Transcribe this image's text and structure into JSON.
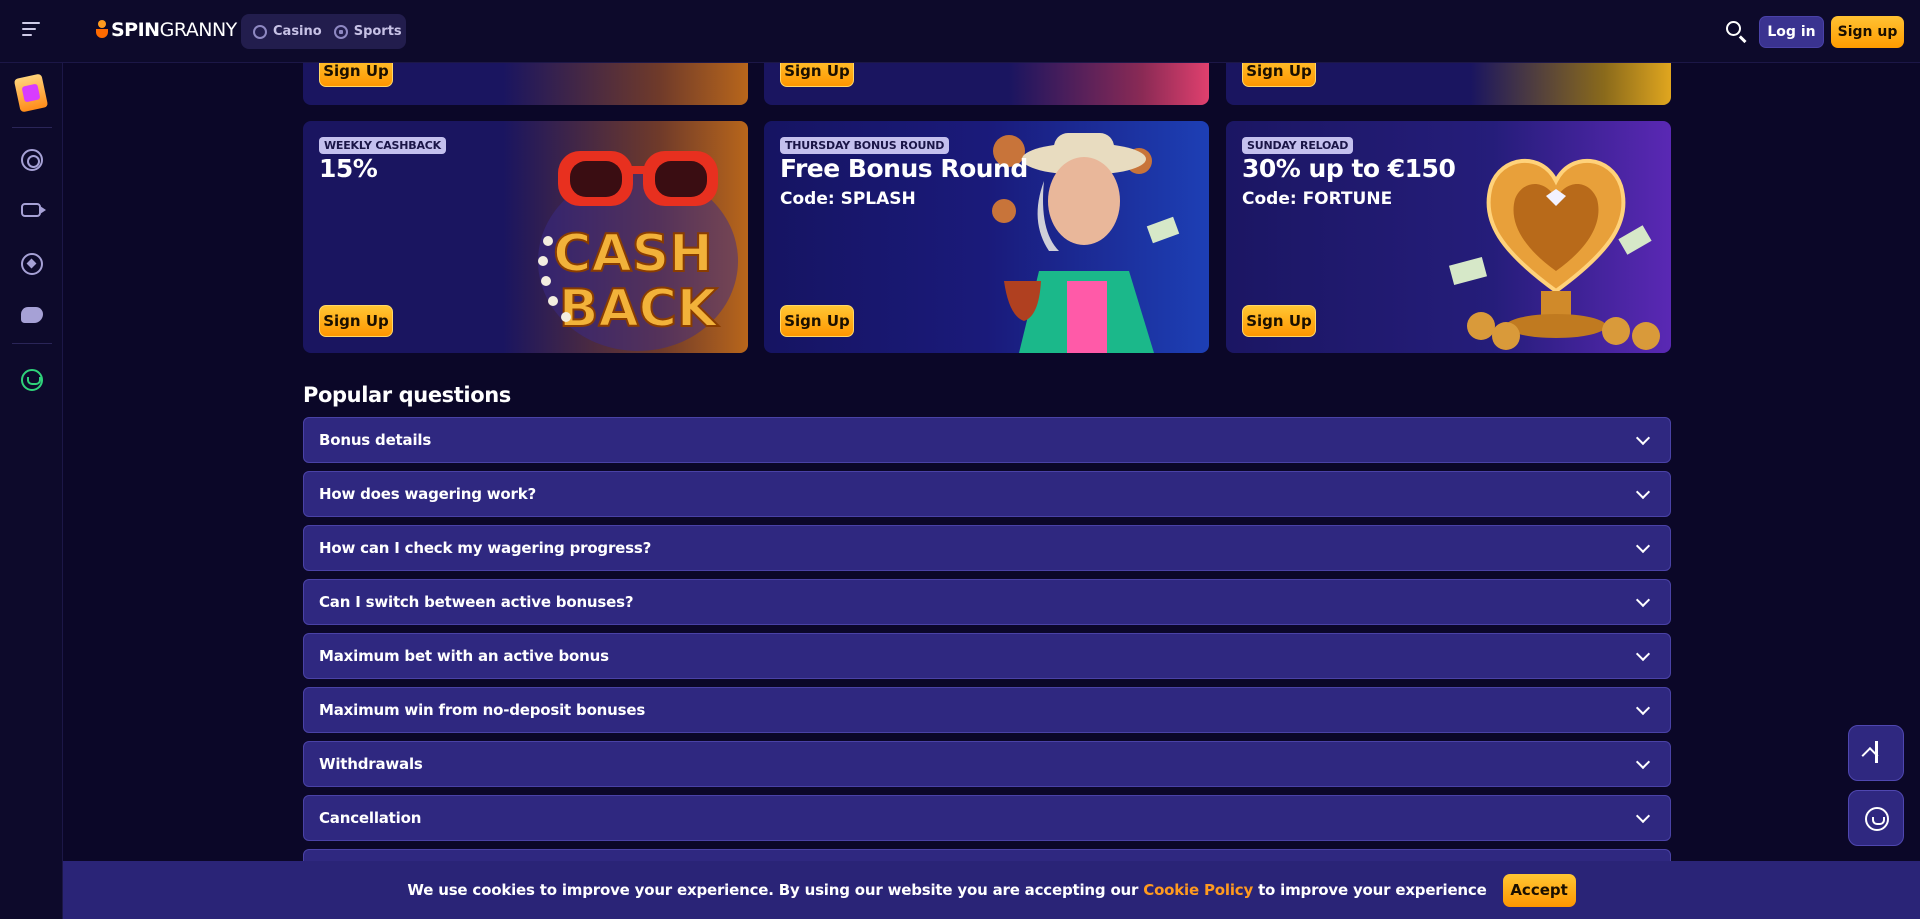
{
  "header": {
    "logo_text_a": "SPIN",
    "logo_text_b": "GRANNY",
    "modes": [
      {
        "label": "Casino",
        "icon": "casino-icon"
      },
      {
        "label": "Sports",
        "icon": "sports-ball-icon"
      }
    ],
    "login_label": "Log in",
    "signup_label": "Sign up"
  },
  "sidebar": {
    "icons": [
      "promo-gift-icon",
      "casino-chip-icon",
      "live-camera-icon",
      "sports-ball-icon",
      "gamepad-icon",
      "support-headset-icon"
    ]
  },
  "top_cards": [
    {
      "button": "Sign Up"
    },
    {
      "button": "Sign Up"
    },
    {
      "button": "Sign Up"
    }
  ],
  "promo_cards": [
    {
      "tag": "WEEKLY CASHBACK",
      "title": "15%",
      "code": "",
      "button": "Sign Up",
      "art": "CASH BACK"
    },
    {
      "tag": "THURSDAY BONUS ROUND",
      "title": "Free Bonus Round",
      "code": "Code: SPLASH",
      "button": "Sign Up"
    },
    {
      "tag": "SUNDAY RELOAD",
      "title": "30% up to €150",
      "code": "Code: FORTUNE",
      "button": "Sign Up"
    }
  ],
  "faq": {
    "heading": "Popular questions",
    "items": [
      "Bonus details",
      "How does wagering work?",
      "How can I check my wagering progress?",
      "Can I switch between active bonuses?",
      "Maximum bet with an active bonus",
      "Maximum win from no-deposit bonuses",
      "Withdrawals",
      "Cancellation"
    ]
  },
  "cookie": {
    "text_before": "We use cookies to improve your experience. By using our website you are accepting our ",
    "link": "Cookie Policy",
    "text_after": " to improve your experience",
    "accept_label": "Accept"
  },
  "colors": {
    "background": "#0b0728",
    "accent": "#ffb21a",
    "panel": "#2f2880",
    "link": "#ff9a1f"
  }
}
